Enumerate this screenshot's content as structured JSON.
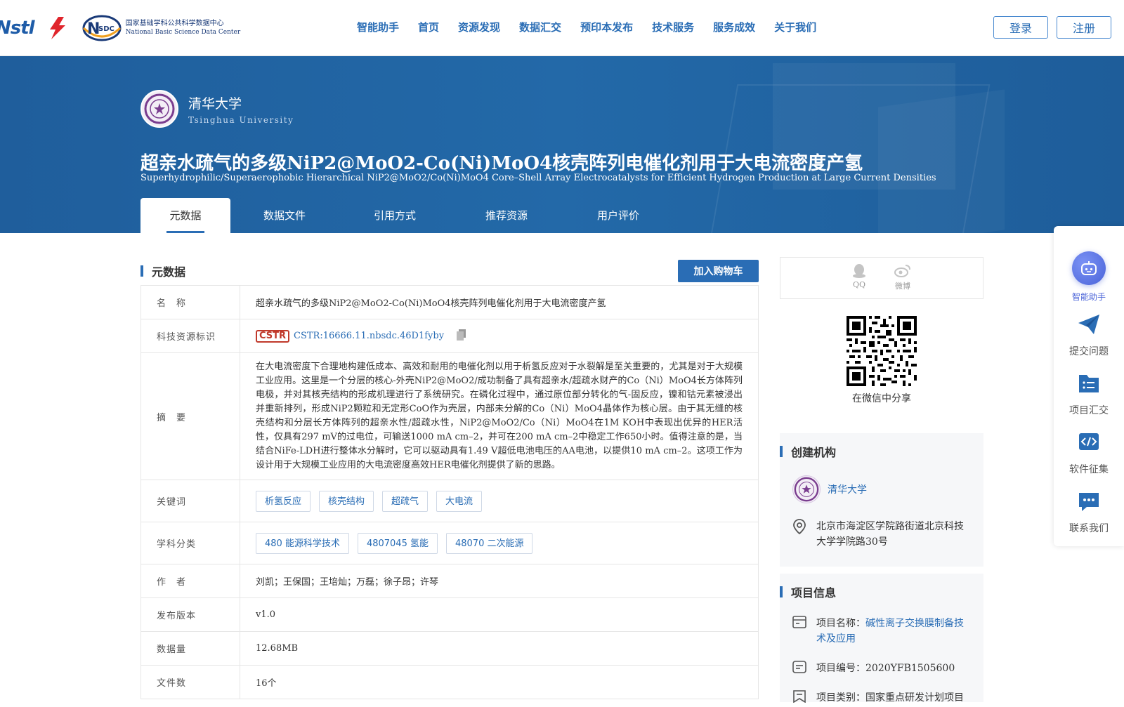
{
  "header": {
    "logo_nstl": "Nstl",
    "logo_nsdc_cn": "国家基础学科公共科学数据中心",
    "logo_nsdc_en": "National Basic Science Data Center",
    "logo_nsdc_mark": "SDC",
    "nav": [
      "智能助手",
      "首页",
      "资源发现",
      "数据汇交",
      "预印本发布",
      "技术服务",
      "服务成效",
      "关于我们"
    ],
    "login": "登录",
    "register": "注册"
  },
  "hero": {
    "institution_cn": "清华大学",
    "institution_en": "Tsinghua University",
    "title_cn": "超亲水疏气的多级NiP2@MoO2-Co(Ni)MoO4核壳阵列电催化剂用于大电流密度产氢",
    "title_en": "Superhydrophilic/Superaerophobic Hierarchical NiP2@MoO2/Co(Ni)MoO4 Core–Shell Array Electrocatalysts for Efficient Hydrogen Production at Large Current Densities",
    "tabs": [
      "元数据",
      "数据文件",
      "引用方式",
      "推荐资源",
      "用户评价"
    ]
  },
  "main": {
    "section_title": "元数据",
    "cart_button": "加入购物车",
    "rows": {
      "name_label": "名　称",
      "name_value": "超亲水疏气的多级NiP2@MoO2-Co(Ni)MoO4核壳阵列电催化剂用于大电流密度产氢",
      "cstr_label": "科技资源标识",
      "cstr_badge": "CSTR",
      "cstr_value": "CSTR:16666.11.nbsdc.46D1fyby",
      "abstract_label": "摘　要",
      "abstract_value": "在大电流密度下合理地构建低成本、高效和耐用的电催化剂以用于析氢反应对于水裂解是至关重要的，尤其是对于大规模工业应用。这里是一个分层的核心-外壳NiP2@MoO2/成功制备了具有超亲水/超疏水财产的Co（Ni）MoO4长方体阵列电极，并对其核壳结构的形成机理进行了系统研究。在磷化过程中，通过原位部分转化的气-固反应，镍和钴元素被浸出并重新排列，形成NiP2颗粒和无定形CoO作为壳层，内部未分解的Co（Ni）MoO4晶体作为核心层。由于其无缝的核壳结构和分层长方体阵列的超亲水性/超疏水性，NiP2@MoO2/Co（Ni）MoO4在1M KOH中表现出优异的HER活性，仅具有297 mV的过电位，可输送1000 mA cm–2，并可在200 mA cm–2中稳定工作650小时。值得注意的是，当结合NiFe-LDH进行整体水分解时，它可以驱动具有1.49 V超低电池电压的AA电池，以提供10 mA cm–2。这项工作为设计用于大规模工业应用的大电流密度高效HER电催化剂提供了新的思路。",
      "keywords_label": "关键词",
      "keywords": [
        "析氢反应",
        "核壳结构",
        "超疏气",
        "大电流"
      ],
      "subject_label": "学科分类",
      "subjects": [
        "480 能源科学技术",
        "4807045 氢能",
        "48070 二次能源"
      ],
      "authors_label": "作　者",
      "authors_value": "刘凯；王保国；王培灿；万磊；徐子昂；许琴",
      "version_label": "发布版本",
      "version_value": "v1.0",
      "size_label": "数据量",
      "size_value": "12.68MB",
      "files_label": "文件数",
      "files_value": "16个"
    }
  },
  "right": {
    "share_qq": "QQ",
    "share_weibo": "微博",
    "qr_caption": "在微信中分享",
    "org_title": "创建机构",
    "org_name": "清华大学",
    "org_address": "北京市海淀区学院路街道北京科技大学学院路30号",
    "project_title": "项目信息",
    "project_name_label": "项目名称：",
    "project_name_value": "碱性离子交换膜制备技术及应用",
    "project_no": "项目编号：2020YFB1505600",
    "project_type": "项目类别：国家重点研发计划项目"
  },
  "sidebar": {
    "assistant": "智能助手",
    "submit_issue": "提交问题",
    "project_collect": "项目汇交",
    "software_collect": "软件征集",
    "contact": "联系我们"
  },
  "colors": {
    "brand": "#2a6db5",
    "hero_bg": "#2369a8",
    "assistant": "#4a63d8"
  }
}
